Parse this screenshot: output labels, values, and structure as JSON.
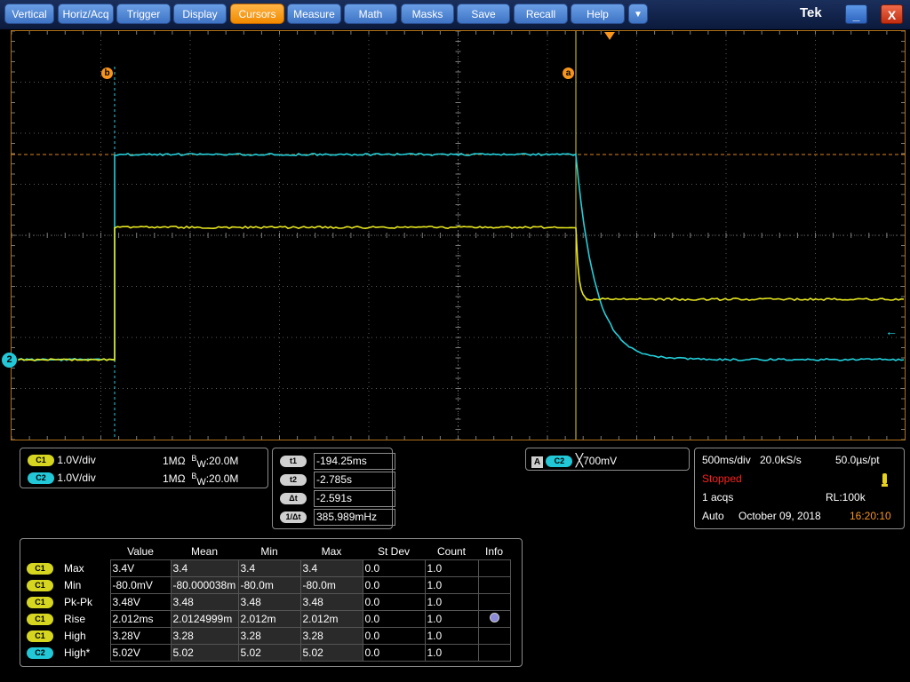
{
  "menu": {
    "items": [
      "Vertical",
      "Horiz/Acq",
      "Trigger",
      "Display",
      "Cursors",
      "Measure",
      "Math",
      "Masks",
      "Save",
      "Recall",
      "Help"
    ],
    "active": "Cursors",
    "dropdown_glyph": "▼"
  },
  "brand": "Tek",
  "window_controls": {
    "minimize": "_",
    "close": "X"
  },
  "markers": {
    "cursor_b": "b",
    "cursor_a": "a",
    "ch2_ground": "2"
  },
  "colors": {
    "ch1": "#e6e61e",
    "ch2": "#22d0dc",
    "cursor": "#f7941d"
  },
  "channels": [
    {
      "badge": "C1",
      "scale": "1.0V/div",
      "impedance": "1MΩ",
      "bw_label": "W",
      "bw_value": ":20.0M"
    },
    {
      "badge": "C2",
      "scale": "1.0V/div",
      "impedance": "1MΩ",
      "bw_label": "W",
      "bw_value": ":20.0M"
    }
  ],
  "cursors": [
    {
      "label": "t1",
      "value": "-194.25ms"
    },
    {
      "label": "t2",
      "value": "-2.785s"
    },
    {
      "label": "Δt",
      "value": "-2.591s"
    },
    {
      "label": "1/Δt",
      "value": "385.989mHz"
    }
  ],
  "trigger": {
    "mode_badge": "A",
    "source": "C2",
    "slope_glyph": "╳",
    "level": "700mV"
  },
  "acquisition": {
    "timebase": "500ms/div",
    "sample_rate": "20.0kS/s",
    "resolution": "50.0µs/pt",
    "status": "Stopped",
    "acqs": "1 acqs",
    "record_length": "RL:100k",
    "trigger_mode": "Auto",
    "date": "October 09, 2018",
    "time": "16:20:10"
  },
  "measurements": {
    "headers": [
      "Value",
      "Mean",
      "Min",
      "Max",
      "St Dev",
      "Count",
      "Info"
    ],
    "rows": [
      {
        "ch": "C1",
        "name": "Max",
        "value": "3.4V",
        "mean": "3.4",
        "min": "3.4",
        "max": "3.4",
        "stdev": "0.0",
        "count": "1.0",
        "info": ""
      },
      {
        "ch": "C1",
        "name": "Min",
        "value": "-80.0mV",
        "mean": "-80.000038m",
        "min": "-80.0m",
        "max": "-80.0m",
        "stdev": "0.0",
        "count": "1.0",
        "info": ""
      },
      {
        "ch": "C1",
        "name": "Pk-Pk",
        "value": "3.48V",
        "mean": "3.48",
        "min": "3.48",
        "max": "3.48",
        "stdev": "0.0",
        "count": "1.0",
        "info": ""
      },
      {
        "ch": "C1",
        "name": "Rise",
        "value": "2.012ms",
        "mean": "2.0124999m",
        "min": "2.012m",
        "max": "2.012m",
        "stdev": "0.0",
        "count": "1.0",
        "info": "dot"
      },
      {
        "ch": "C1",
        "name": "High",
        "value": "3.28V",
        "mean": "3.28",
        "min": "3.28",
        "max": "3.28",
        "stdev": "0.0",
        "count": "1.0",
        "info": ""
      },
      {
        "ch": "C2",
        "name": "High*",
        "value": "5.02V",
        "mean": "5.02",
        "min": "5.02",
        "max": "5.02",
        "stdev": "0.0",
        "count": "1.0",
        "info": ""
      }
    ]
  }
}
